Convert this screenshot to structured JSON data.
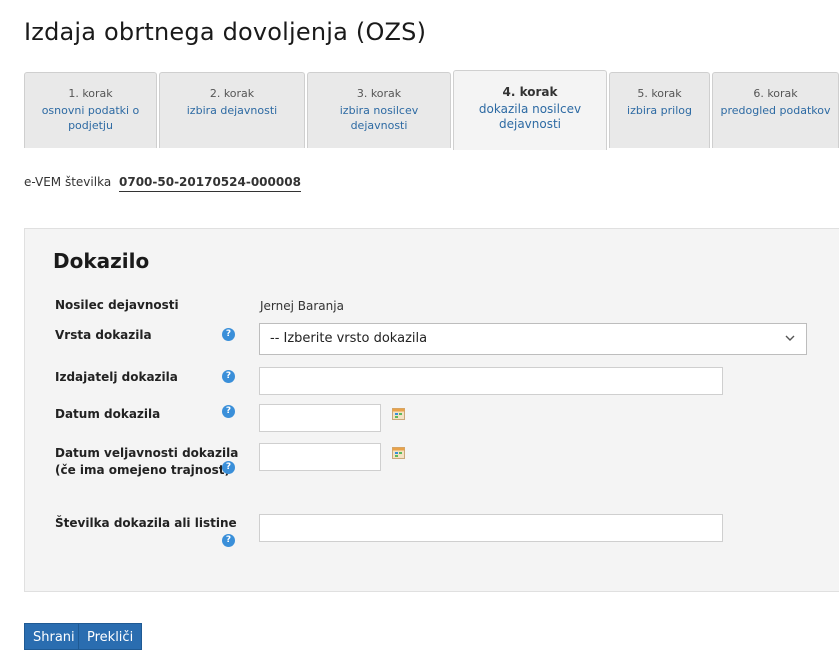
{
  "page": {
    "title": "Izdaja obrtnega dovoljenja (OZS)"
  },
  "tabs": [
    {
      "step": "1. korak",
      "desc": "osnovni podatki o podjetju"
    },
    {
      "step": "2. korak",
      "desc": "izbira dejavnosti"
    },
    {
      "step": "3. korak",
      "desc": "izbira nosilcev dejavnosti"
    },
    {
      "step": "4. korak",
      "desc": "dokazila nosilcev dejavnosti"
    },
    {
      "step": "5. korak",
      "desc": "izbira prilog"
    },
    {
      "step": "6. korak",
      "desc": "predogled podatkov"
    }
  ],
  "active_tab": "4. korak",
  "evem": {
    "label": "e-VEM številka",
    "number": "0700-50-20170524-000008"
  },
  "form": {
    "heading": "Dokazilo",
    "holder_label": "Nosilec dejavnosti",
    "holder_value": "Jernej Baranja",
    "type_label": "Vrsta dokazila",
    "type_selected": "-- Izberite vrsto dokazila",
    "issuer_label": "Izdajatelj dokazila",
    "issuer_value": "",
    "date_label": "Datum dokazila",
    "date_value": "",
    "validity_label": "Datum veljavnosti dokazila (če ima omejeno trajnost)",
    "validity_value": "",
    "number_label": "Številka dokazila ali listine",
    "number_value": ""
  },
  "help_glyph": "?",
  "icons": {
    "help": "help-icon",
    "calendar": "calendar-icon",
    "dropdown": "chevron-down-icon"
  },
  "buttons": {
    "save": "Shrani",
    "cancel": "Prekliči"
  },
  "colors": {
    "link": "#2d6aa3",
    "button": "#2a6db0",
    "help": "#3a8fd9",
    "panel": "#f4f4f4"
  }
}
